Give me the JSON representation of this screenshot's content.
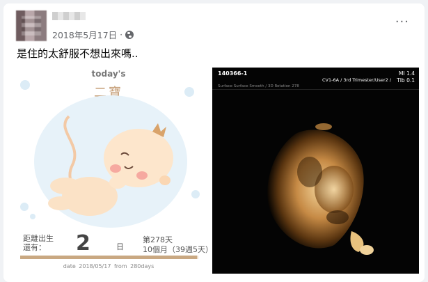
{
  "post": {
    "date": "2018年5月17日",
    "separator": "·",
    "more_label": "···",
    "caption": "是住的太舒服不想出來嗎.."
  },
  "app_card": {
    "today_label": "today's",
    "baby_name": "二寶",
    "countdown_label": "距離出生還有：",
    "countdown_number": "2",
    "countdown_unit": "日",
    "day_of_pregnancy": "第278天",
    "weeks_text": "10個月（39週5天）",
    "progress": 0.993,
    "footer_date": "date 2018/05/17",
    "footer_from": "from 280days",
    "colors": {
      "accent": "#c49c74",
      "bubble": "#dcecf6"
    }
  },
  "ultrasound": {
    "patient_id": "140366-1",
    "probe_info": "CV1-6A / 3rd Trimester/User2 /",
    "mode_info": "Surface Surface Smooth / 3D Rotation 278",
    "mi": "MI 1.4",
    "tib": "TIb 0.1"
  },
  "icons": {
    "globe": "globe-icon",
    "more": "more-options-icon",
    "baby": "baby-illustration-icon"
  }
}
